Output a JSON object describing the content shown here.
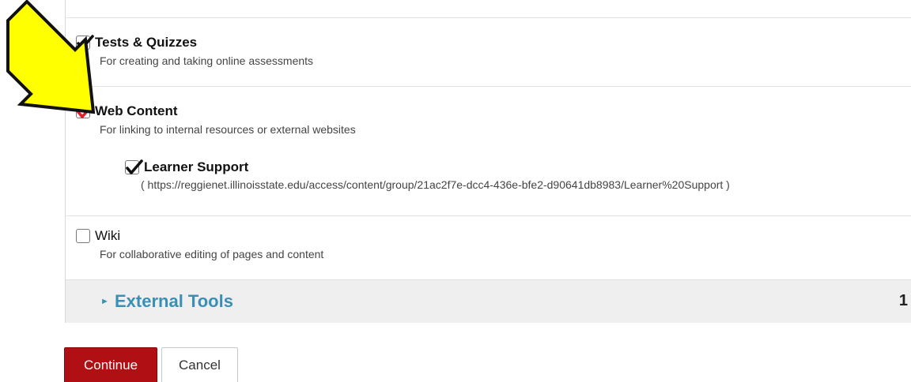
{
  "tools": [
    {
      "id": "tests",
      "label": "Tests & Quizzes",
      "description": "For creating and taking online assessments",
      "checked": true
    },
    {
      "id": "web",
      "label": "Web Content",
      "description": "For linking to internal resources or external websites",
      "checked": true
    },
    {
      "id": "wiki",
      "label": "Wiki",
      "description": "For collaborative editing of pages and content",
      "checked": false
    }
  ],
  "web_sub": {
    "label": "Learner Support",
    "url": "( https://reggienet.illinoisstate.edu/access/content/group/21ac2f7e-dcc4-436e-bfe2-d90641db8983/Learner%20Support )",
    "checked": true
  },
  "external_tools": {
    "title": "External Tools",
    "count": "1"
  },
  "buttons": {
    "continue": "Continue",
    "cancel": "Cancel"
  },
  "colors": {
    "accent": "#3a8fb7",
    "primary_button": "#b00f13",
    "highlight_check": "#e0202a",
    "arrow_fill": "#ffff00"
  },
  "icons": {
    "pointer": "yellow-arrow-icon",
    "expand": "triangle-right-icon",
    "check": "checkmark-icon"
  }
}
